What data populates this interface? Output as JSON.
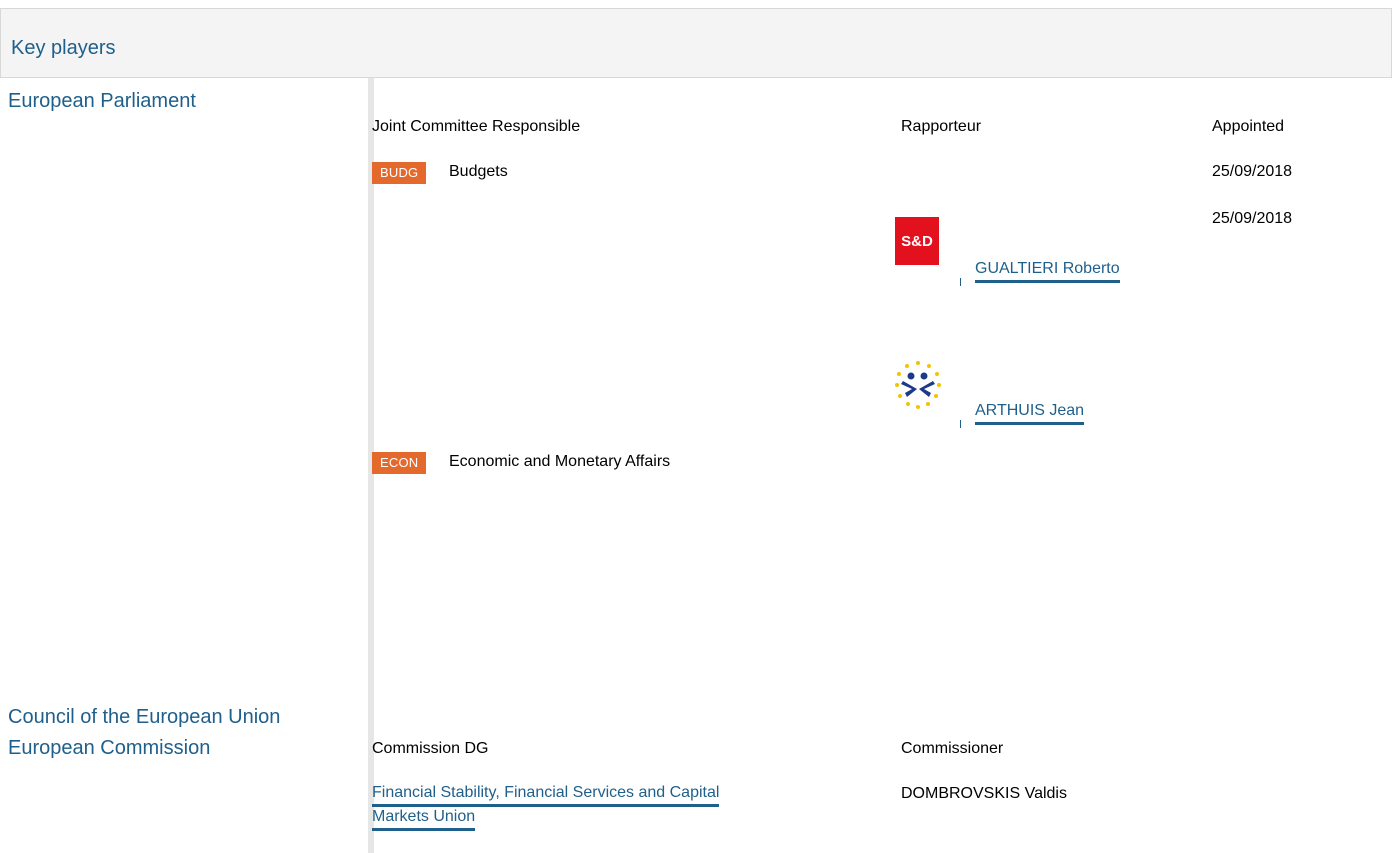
{
  "header": {
    "title": "Key players"
  },
  "parliament": {
    "label": "European Parliament",
    "columns": {
      "committee": "Joint Committee Responsible",
      "rapporteur": "Rapporteur",
      "appointed": "Appointed"
    },
    "committees": [
      {
        "tag": "BUDG",
        "name": "Budgets",
        "appointed": "25/09/2018"
      },
      {
        "tag": "ECON",
        "name": "Economic and Monetary Affairs"
      }
    ],
    "rapporteurs": [
      {
        "group_logo": "S&D",
        "name": "GUALTIERI Roberto",
        "appointed": "25/09/2018"
      },
      {
        "group_logo": "renew-europe-logo",
        "name": "ARTHUIS Jean"
      }
    ]
  },
  "council": {
    "label": "Council of the European Union"
  },
  "commission": {
    "label": "European Commission",
    "columns": {
      "dg": "Commission DG",
      "commissioner": "Commissioner"
    },
    "dg_line1": "Financial Stability, Financial Services and Capital",
    "dg_line2": "Markets Union",
    "commissioner": "DOMBROVSKIS Valdis"
  },
  "colors": {
    "accent": "#1f5f8b",
    "tag_bg": "#e36a2c",
    "sd_red": "#e3101e"
  }
}
